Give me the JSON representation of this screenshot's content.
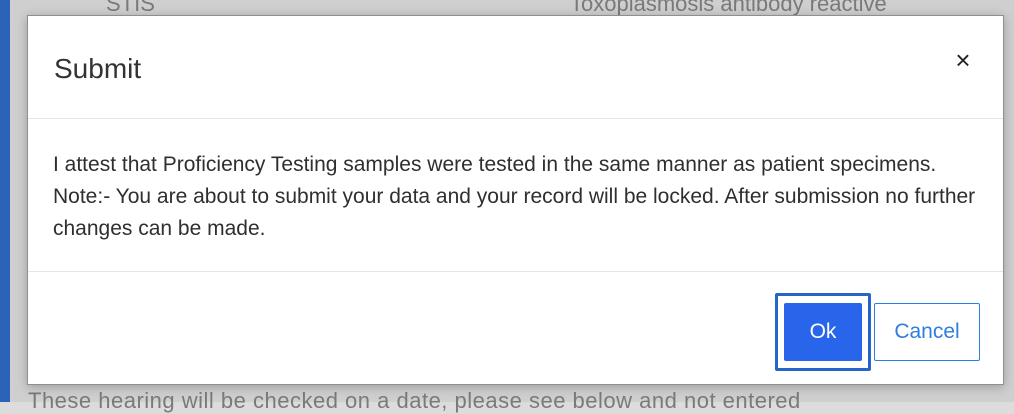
{
  "background": {
    "top_left_text": "STIS",
    "top_right_text": "Toxoplasmosis antibody reactive",
    "bottom_text": "These hearing will be checked on a date, please see below and not entered"
  },
  "dialog": {
    "title": "Submit",
    "close_label": "×",
    "message": "I attest that Proficiency Testing samples were tested in the same manner as patient specimens. Note:- You are about to submit your data and your record will be locked. After submission no further changes can be made.",
    "buttons": {
      "ok": "Ok",
      "cancel": "Cancel"
    }
  },
  "colors": {
    "primary": "#2865ea",
    "accent": "#2f7de1",
    "focus_ring": "#2565c7"
  }
}
